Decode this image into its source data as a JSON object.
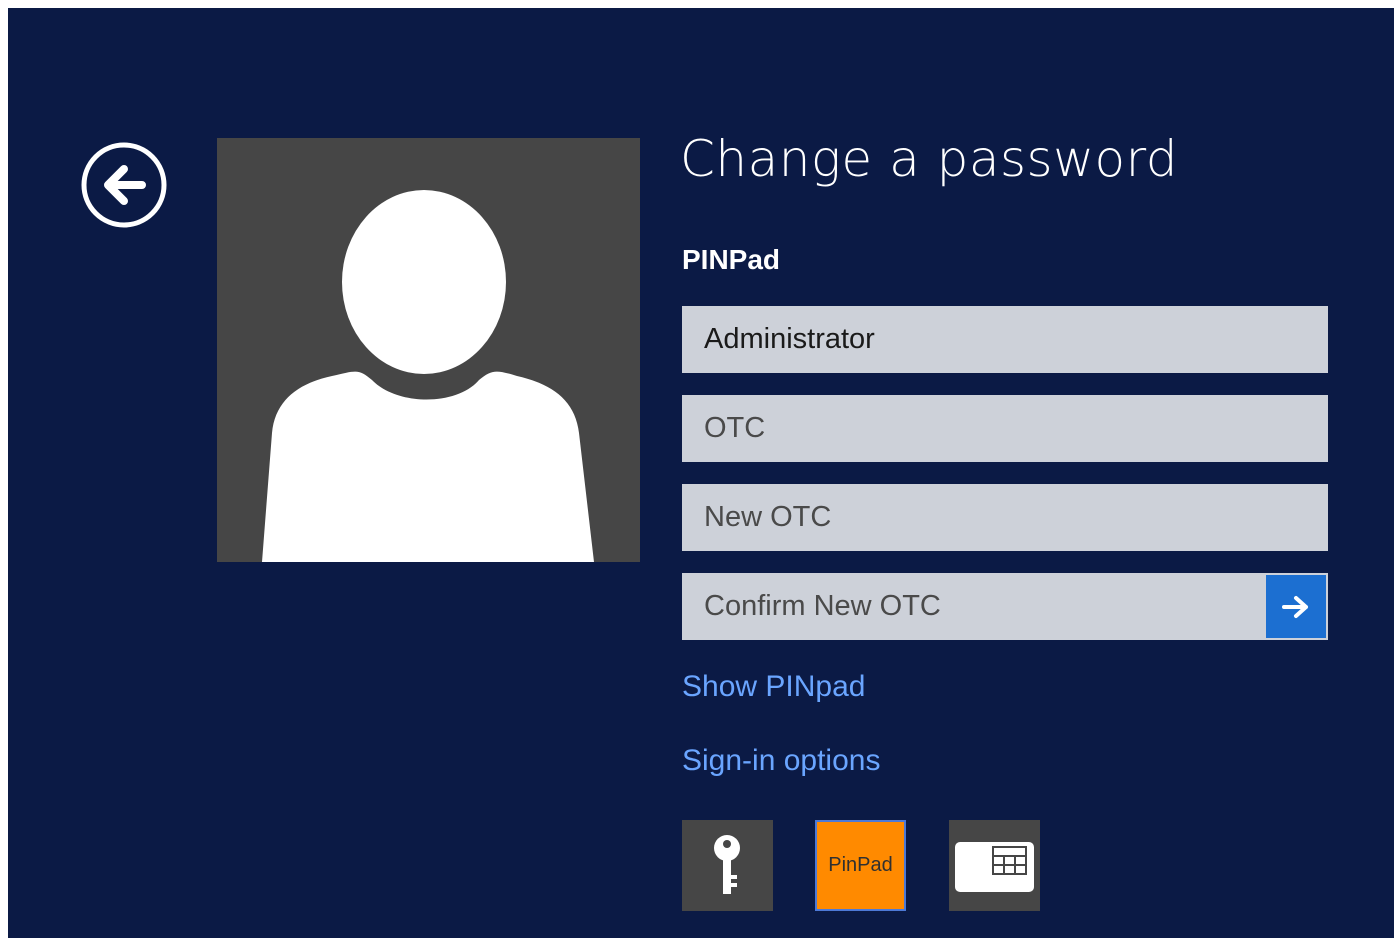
{
  "page": {
    "title": "Change a password"
  },
  "credential_provider": {
    "name": "PINPad"
  },
  "form": {
    "username_value": "Administrator",
    "otc_placeholder": "OTC",
    "new_otc_placeholder": "New OTC",
    "confirm_new_otc_placeholder": "Confirm New OTC"
  },
  "links": {
    "show_pinpad": "Show PINpad",
    "sign_in_options": "Sign-in options"
  },
  "sign_in_tiles": [
    {
      "id": "password",
      "icon": "key-icon"
    },
    {
      "id": "pinpad",
      "label": "PinPad",
      "selected": true
    },
    {
      "id": "smart-card",
      "icon": "smart-card-icon"
    }
  ],
  "colors": {
    "background": "#0b1a45",
    "field": "#cdd1d9",
    "accent": "#1c6fd1",
    "link": "#6aa5ff",
    "selected_tile": "#ff8a00",
    "tile": "#464646"
  }
}
